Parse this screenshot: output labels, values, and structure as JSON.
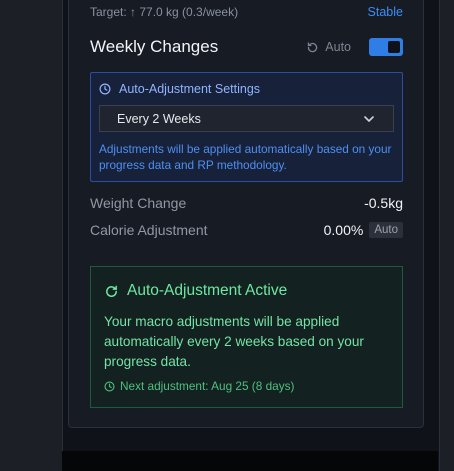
{
  "header": {
    "target_text": "Target: ↑ 77.0 kg (0.3/week)",
    "status_link": "Stable"
  },
  "weekly": {
    "title": "Weekly Changes",
    "auto_label": "Auto",
    "auto_enabled": true
  },
  "settings": {
    "title": "Auto-Adjustment Settings",
    "frequency_selected": "Every 2 Weeks",
    "help_text": "Adjustments will be applied automatically based on your progress data and RP methodology."
  },
  "stats": {
    "weight_change_label": "Weight Change",
    "weight_change_value": "-0.5kg",
    "calorie_adjustment_label": "Calorie Adjustment",
    "calorie_adjustment_value": "0.00%",
    "calorie_badge": "Auto"
  },
  "active": {
    "title": "Auto-Adjustment Active",
    "body": "Your macro adjustments will be applied automatically every 2 weeks based on your progress data.",
    "next_adjustment": "Next adjustment: Aug 25 (8 days)"
  },
  "colors": {
    "accent_blue": "#2e7ee6",
    "success_green": "#6ee7a0",
    "panel_bg": "#161b24"
  }
}
